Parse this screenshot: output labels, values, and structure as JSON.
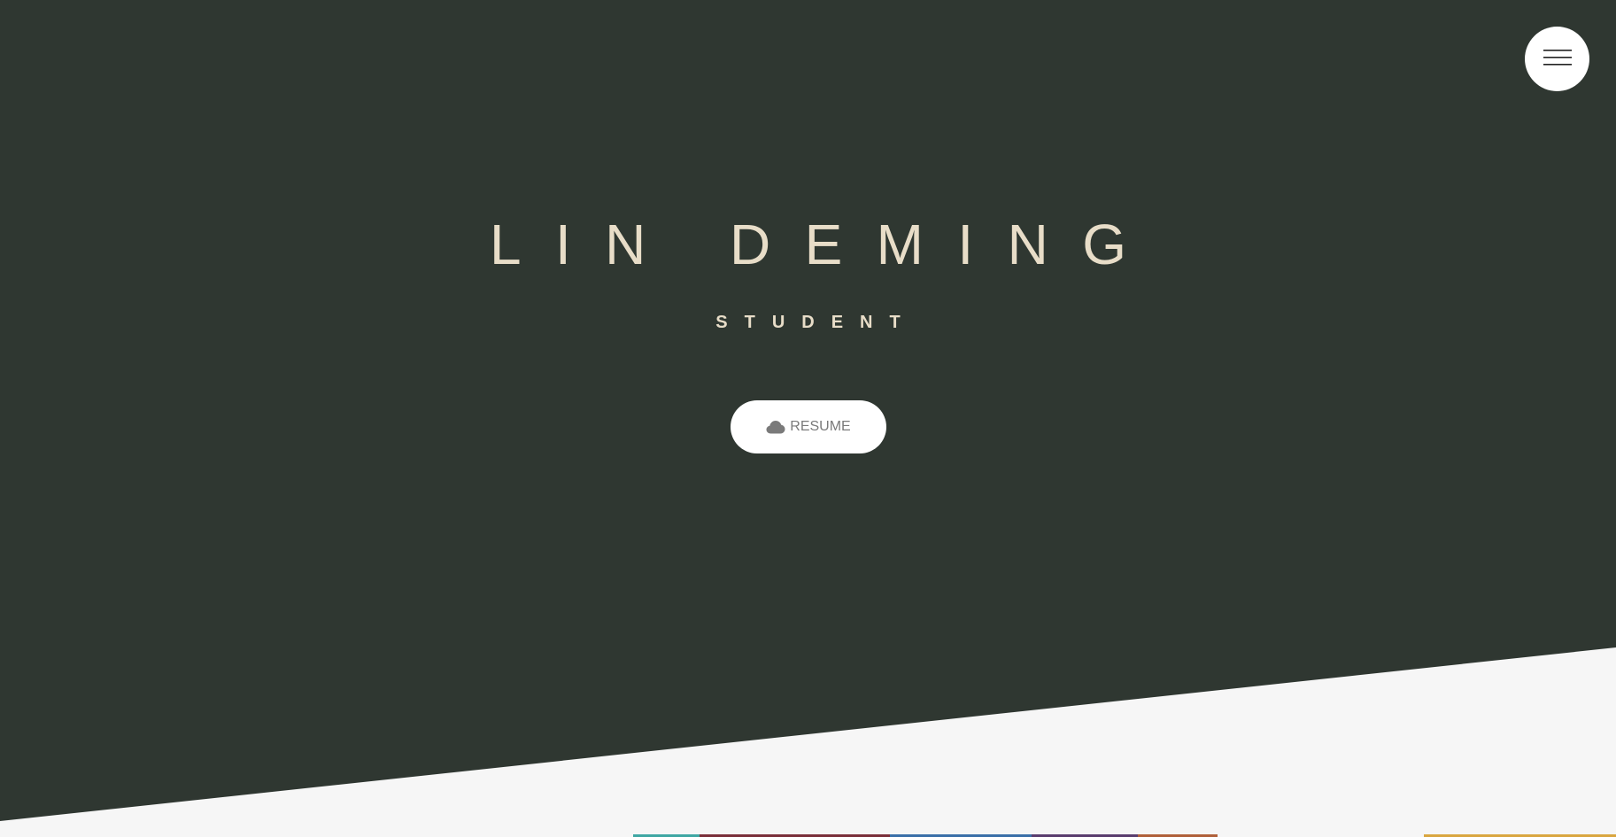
{
  "hero": {
    "name": "LIN DEMING",
    "role": "STUDENT",
    "resume_label": "RESUME"
  },
  "icons": {
    "resume": "cloud-icon",
    "menu": "hamburger-menu-icon"
  },
  "colors": {
    "hero_background": "#2f3731",
    "page_background": "#f6f6f6",
    "title_text": "#e8ddc8",
    "button_background": "#ffffff",
    "button_text": "#7a7a7a"
  }
}
